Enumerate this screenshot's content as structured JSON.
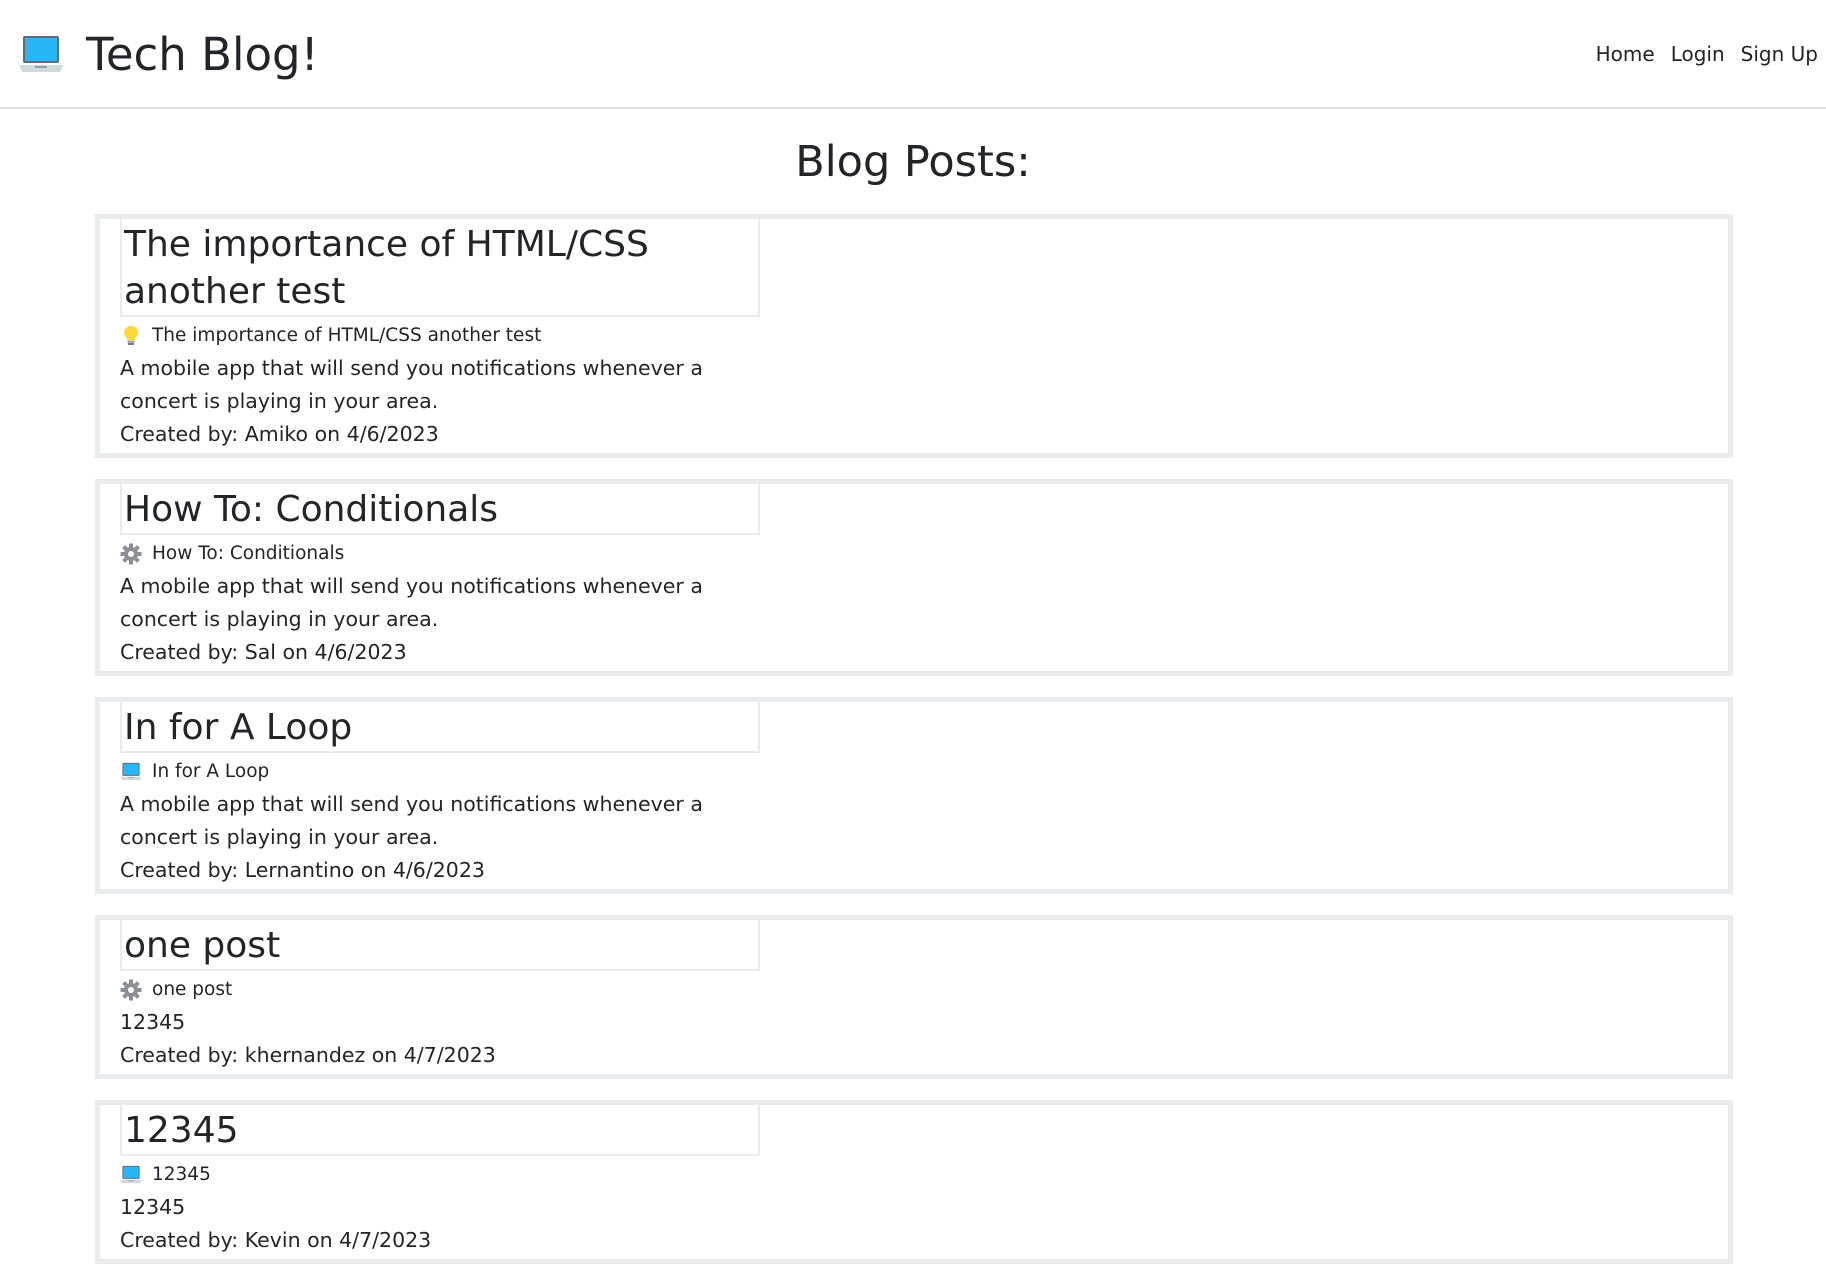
{
  "site": {
    "title": "Tech Blog!",
    "icon": "laptop-icon"
  },
  "nav": {
    "home": "Home",
    "login": "Login",
    "signup": "Sign Up"
  },
  "page": {
    "heading": "Blog Posts:"
  },
  "posts": [
    {
      "title": "The importance of HTML/CSS another test",
      "icon": "lightbulb-icon",
      "subtitle": "The importance of HTML/CSS another test",
      "body": "A mobile app that will send you notifications whenever a concert is playing in your area.",
      "meta": "Created by: Amiko on 4/6/2023"
    },
    {
      "title": "How To: Conditionals",
      "icon": "gear-icon",
      "subtitle": "How To: Conditionals",
      "body": "A mobile app that will send you notifications whenever a concert is playing in your area.",
      "meta": "Created by: Sal on 4/6/2023"
    },
    {
      "title": "In for A Loop",
      "icon": "laptop-icon",
      "subtitle": "In for A Loop",
      "body": "A mobile app that will send you notifications whenever a concert is playing in your area.",
      "meta": "Created by: Lernantino on 4/6/2023"
    },
    {
      "title": "one post",
      "icon": "gear-icon",
      "subtitle": "one post",
      "body": "12345",
      "meta": "Created by: khernandez on 4/7/2023"
    },
    {
      "title": "12345",
      "icon": "laptop-icon",
      "subtitle": "12345",
      "body": "12345",
      "meta": "Created by: Kevin on 4/7/2023"
    }
  ]
}
